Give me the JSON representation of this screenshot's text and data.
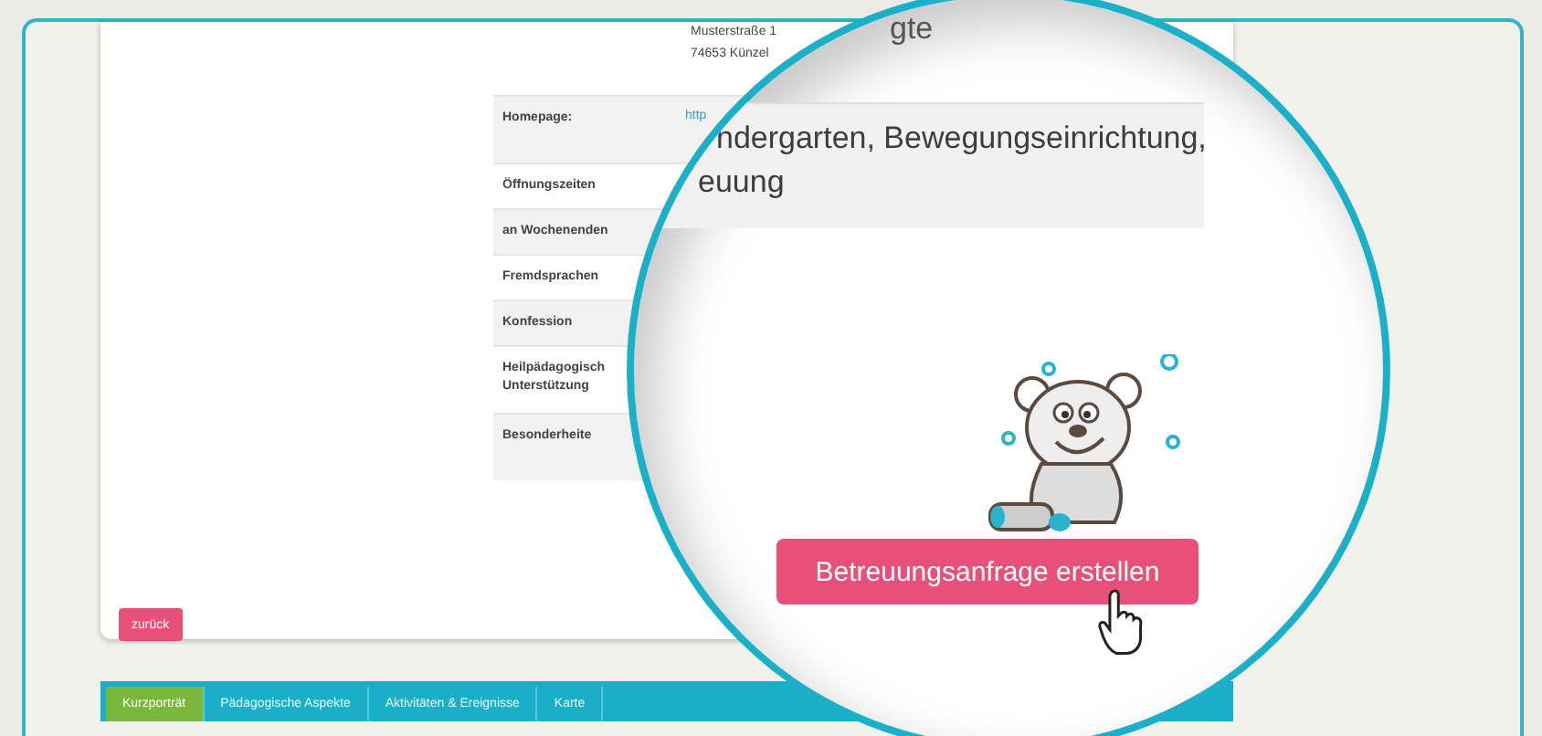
{
  "address": [
    "Musterstraße 1",
    "74653 Künzel"
  ],
  "details": [
    {
      "label": "Homepage:",
      "value": "http"
    },
    {
      "label": "Öffnungszeiten"
    },
    {
      "label": "an Wochenenden"
    },
    {
      "label": "Fremdsprachen"
    },
    {
      "label": "Konfession"
    },
    {
      "label": "Heilpädagogisch Unterstützung"
    },
    {
      "label": "Besonderheite"
    }
  ],
  "back_button": "zurück",
  "tabs": [
    {
      "label": "Kurzporträt",
      "selected": true
    },
    {
      "label": "Pädagogische Aspekte",
      "selected": false
    },
    {
      "label": "Aktivitäten & Ereignisse",
      "selected": false
    },
    {
      "label": "Karte",
      "selected": false
    }
  ],
  "magnifier": {
    "heading_fragment": "gte",
    "lines": [
      "ndergarten, Bewegungseinrichtung,",
      "euung"
    ],
    "button": "Betreuungsanfrage erstellen"
  }
}
